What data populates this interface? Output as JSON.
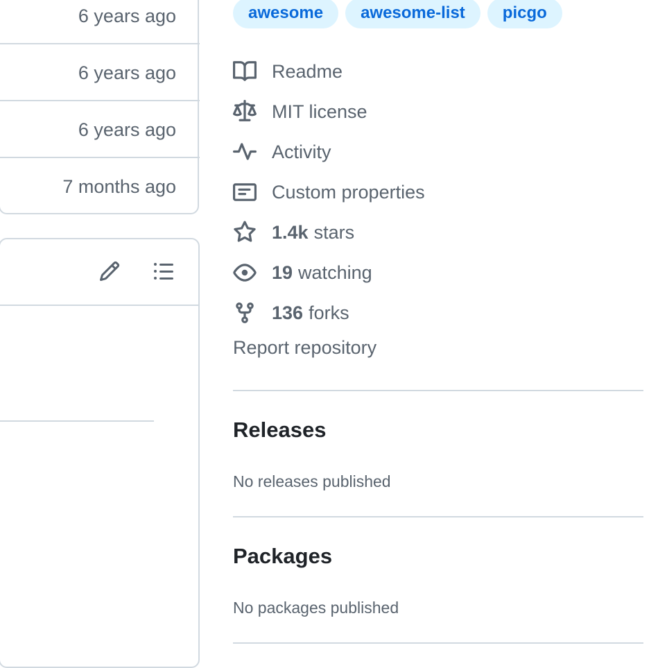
{
  "files": [
    {
      "time": "6 years ago"
    },
    {
      "time": "6 years ago"
    },
    {
      "time": "6 years ago"
    },
    {
      "time": "7 months ago"
    }
  ],
  "topics": [
    "awesome",
    "awesome-list",
    "picgo"
  ],
  "about": {
    "readme": "Readme",
    "license": "MIT license",
    "activity": "Activity",
    "custom_properties": "Custom properties",
    "stars_count": "1.4k",
    "stars_label": "stars",
    "watching_count": "19",
    "watching_label": "watching",
    "forks_count": "136",
    "forks_label": "forks",
    "report": "Report repository"
  },
  "releases": {
    "title": "Releases",
    "empty": "No releases published"
  },
  "packages": {
    "title": "Packages",
    "empty": "No packages published"
  }
}
